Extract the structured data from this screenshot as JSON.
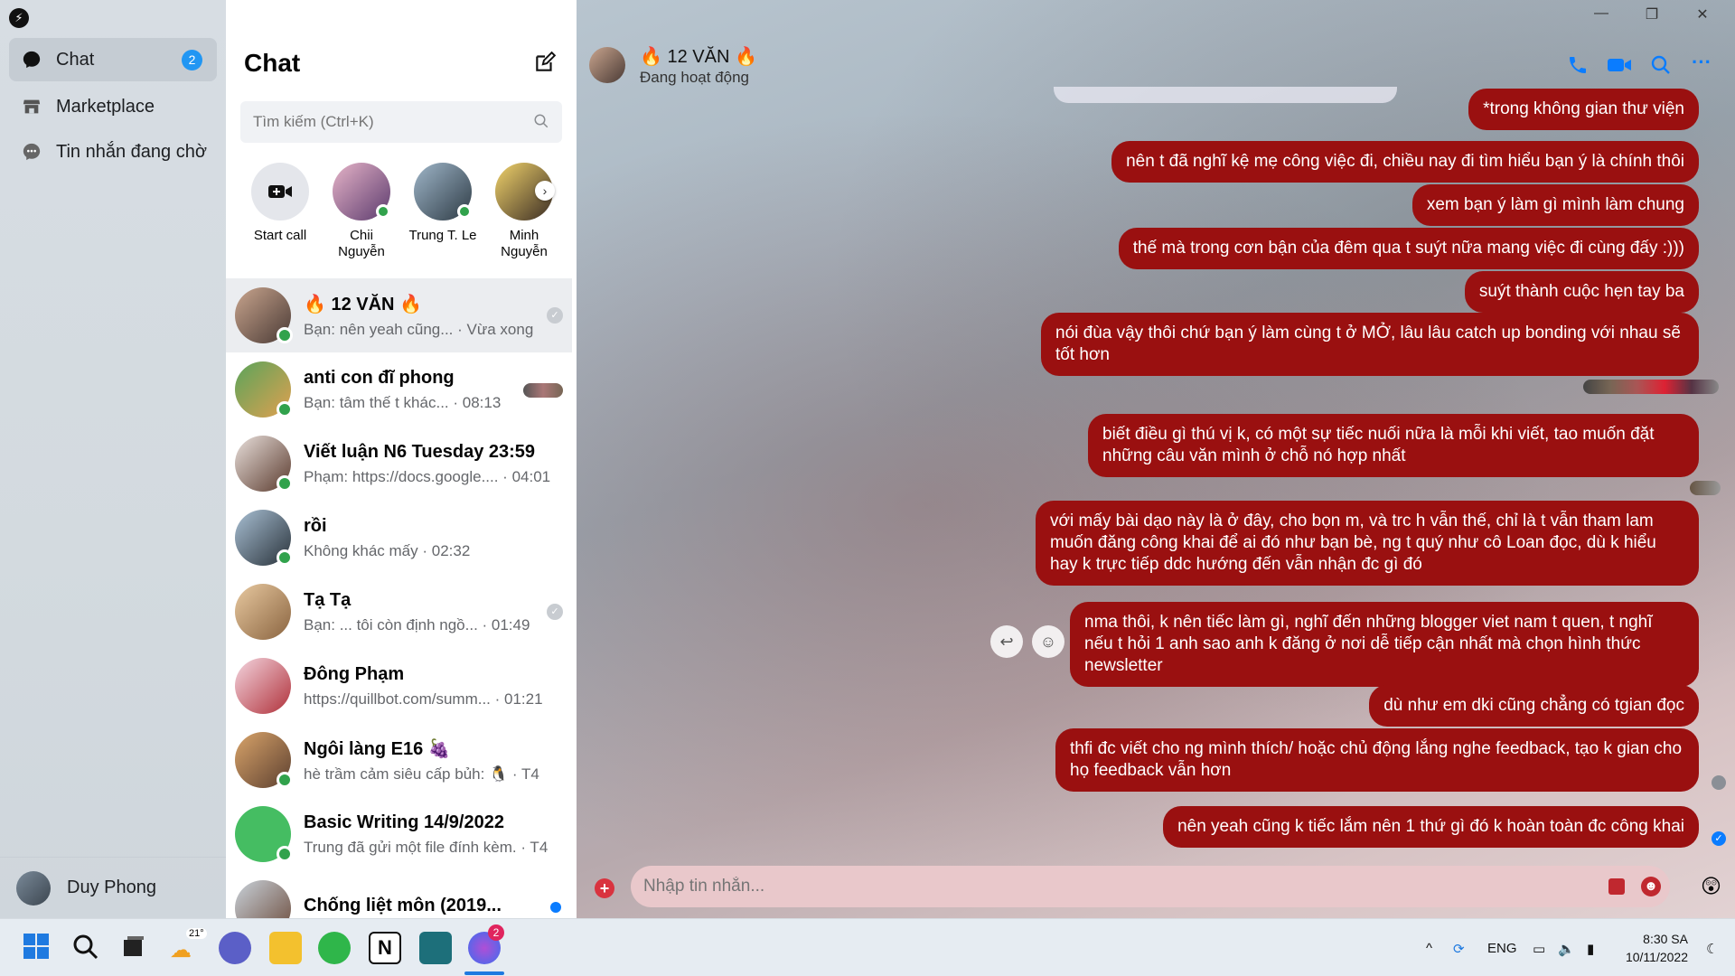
{
  "nav": {
    "items": [
      {
        "label": "Chat",
        "icon": "chat-bubble-icon",
        "badge": "2"
      },
      {
        "label": "Marketplace",
        "icon": "store-icon"
      },
      {
        "label": "Tin nhắn đang chờ",
        "icon": "pending-messages-icon"
      }
    ],
    "user_name": "Duy Phong"
  },
  "chat_list": {
    "title": "Chat",
    "search_placeholder": "Tìm kiếm (Ctrl+K)",
    "stories": [
      {
        "label": "Start call"
      },
      {
        "label": "Chii Nguyễn"
      },
      {
        "label": "Trung T. Le"
      },
      {
        "label": "Minh Nguyễn"
      }
    ],
    "conversations": [
      {
        "name": "🔥 12 VĂN 🔥",
        "preview": "Bạn: nên yeah cũng... · Vừa xong",
        "online": true,
        "selected": true
      },
      {
        "name": "anti con đĩ phong",
        "preview": "Bạn: tâm thế t khác... · 08:13",
        "online": true
      },
      {
        "name": "Viết luận N6 Tuesday 23:59",
        "preview": "Phạm: https://docs.google.... · 04:01",
        "online": true
      },
      {
        "name": "rồi",
        "preview": "Không khác mấy · 02:32",
        "online": true
      },
      {
        "name": "Tạ Tạ",
        "preview": "Bạn: ... tôi còn định ngồ... · 01:49",
        "online": false
      },
      {
        "name": "Đông Phạm",
        "preview": "https://quillbot.com/summ... · 01:21",
        "online": false
      },
      {
        "name": "Ngôi làng E16 🍇",
        "preview": "hè trầm cảm siêu cấp bủh: 🐧 · T4",
        "online": true
      },
      {
        "name": "Basic Writing 14/9/2022",
        "preview": "Trung đã gửi một file đính kèm. · T4",
        "online": true
      },
      {
        "name": "Chống liệt môn (2019...",
        "preview": "",
        "online": false
      }
    ]
  },
  "conversation": {
    "title": "🔥 12 VĂN 🔥",
    "status": "Đang hoạt động",
    "messages": [
      "*trong không gian thư viện",
      "nên t đã nghĩ kệ mẹ công việc đi, chiều nay đi tìm hiểu bạn ý là chính thôi",
      "xem bạn ý làm gì mình làm chung",
      "thế mà trong cơn bận của đêm qua t suýt nữa mang việc đi cùng đấy :)))",
      "suýt thành cuộc hẹn tay ba",
      "nói đùa vậy thôi chứ bạn ý làm cùng t ở MỞ, lâu lâu catch up bonding với nhau sẽ tốt hơn",
      "biết điều gì thú vị k, có một sự tiếc nuối nữa là mỗi khi viết, tao muốn đặt những câu văn mình ở chỗ nó hợp nhất",
      "với mấy bài dạo này là ở đây, cho bọn m, và trc h vẫn thế, chỉ là t vẫn tham lam muốn đăng công khai để ai đó như bạn bè, ng t quý như cô Loan đọc, dù k hiểu hay k trực tiếp ddc hướng đến vẫn nhận đc gì đó",
      "nma thôi, k nên tiếc làm gì, nghĩ đến những blogger viet nam t quen, t nghĩ nếu t hỏi 1 anh sao anh k đăng ở nơi dễ tiếp cận nhất mà chọn hình thức newsletter",
      "dù như em dki cũng chẳng có tgian đọc",
      "thfi đc viết cho ng mình thích/ hoặc chủ động lắng nghe feedback, tạo k gian cho họ feedback vẫn hơn",
      "nên yeah cũng k tiếc lắm nên 1 thứ gì đó k hoàn toàn đc công khai"
    ],
    "composer_placeholder": "Nhập tin nhắn..."
  },
  "taskbar": {
    "weather": "21°",
    "messenger_badge": "2",
    "language": "ENG",
    "time": "8:30 SA",
    "date": "10/11/2022"
  },
  "colors": {
    "accent": "#0a7cff",
    "bubble": "#9a1010",
    "online": "#31a24c",
    "badge": "#2196f3"
  }
}
